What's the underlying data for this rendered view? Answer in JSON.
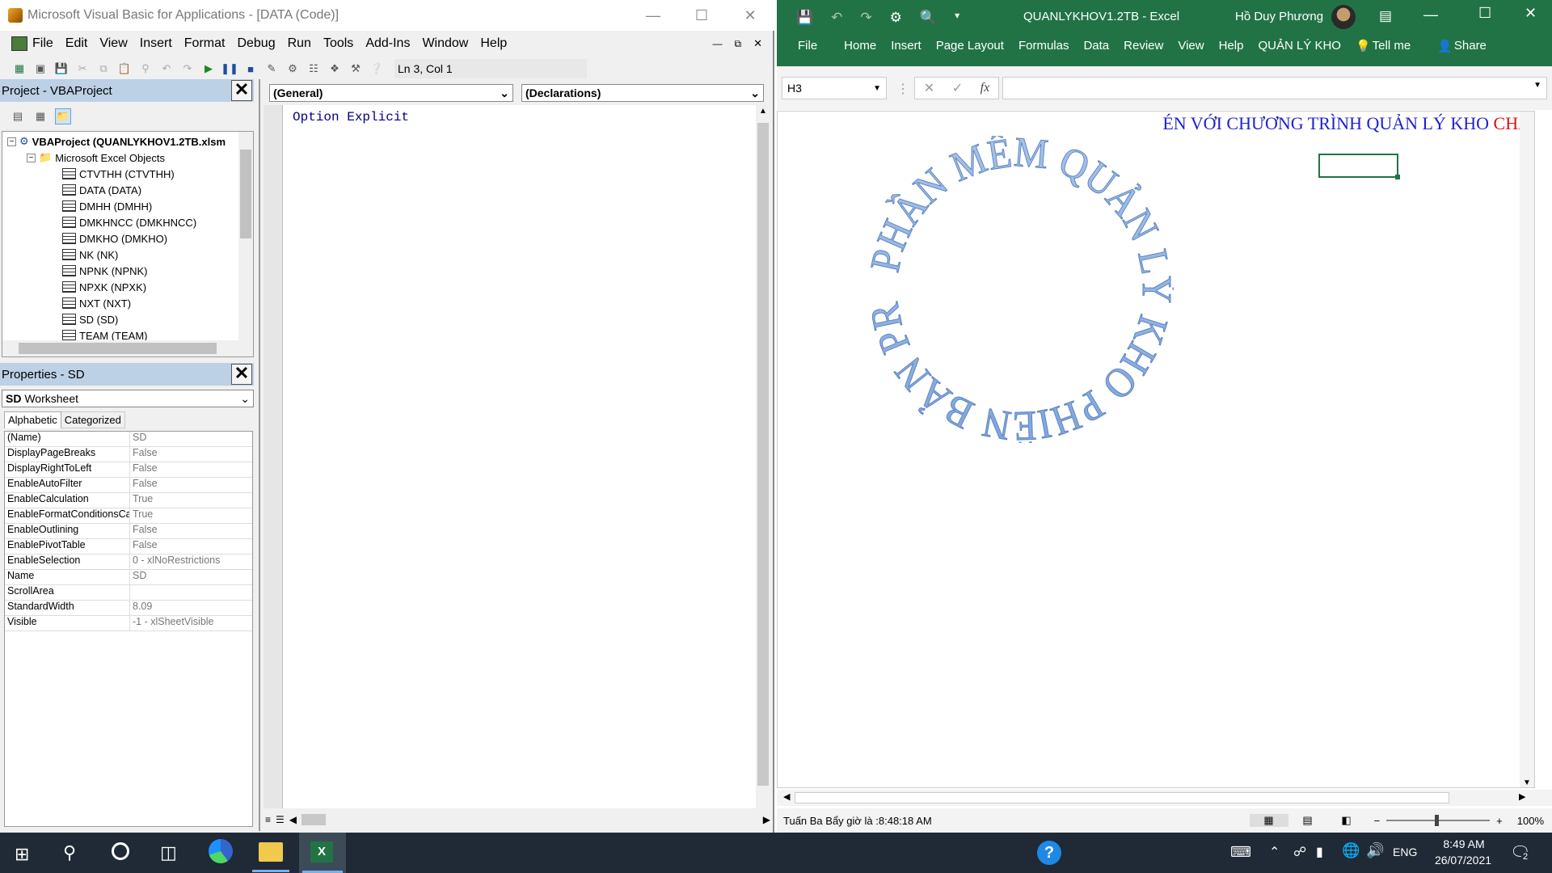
{
  "vba": {
    "title": "Microsoft Visual Basic for Applications - [DATA (Code)]",
    "menu": [
      "File",
      "Edit",
      "View",
      "Insert",
      "Format",
      "Debug",
      "Run",
      "Tools",
      "Add-Ins",
      "Window",
      "Help"
    ],
    "position": "Ln 3, Col 1",
    "project_title": "Project - VBAProject",
    "project_root": "VBAProject (QUANLYKHOV1.2TB.xlsm",
    "folder": "Microsoft Excel Objects",
    "sheets": [
      "CTVTHH (CTVTHH)",
      "DATA (DATA)",
      "DMHH (DMHH)",
      "DMKHNCC (DMKHNCC)",
      "DMKHO (DMKHO)",
      "NK (NK)",
      "NPNK (NPNK)",
      "NPXK (NPXK)",
      "NXT (NXT)",
      "SD (SD)",
      "TEAM (TEAM)"
    ],
    "properties_title": "Properties - SD",
    "object_name": "SD",
    "object_type": "Worksheet",
    "tab_alpha": "Alphabetic",
    "tab_cat": "Categorized",
    "properties": [
      [
        "(Name)",
        "SD"
      ],
      [
        "DisplayPageBreaks",
        "False"
      ],
      [
        "DisplayRightToLeft",
        "False"
      ],
      [
        "EnableAutoFilter",
        "False"
      ],
      [
        "EnableCalculation",
        "True"
      ],
      [
        "EnableFormatConditionsCa",
        "True"
      ],
      [
        "EnableOutlining",
        "False"
      ],
      [
        "EnablePivotTable",
        "False"
      ],
      [
        "EnableSelection",
        "0 - xlNoRestrictions"
      ],
      [
        "Name",
        "SD"
      ],
      [
        "ScrollArea",
        ""
      ],
      [
        "StandardWidth",
        "8.09"
      ],
      [
        "Visible",
        "-1 - xlSheetVisible"
      ]
    ],
    "combo_general": "(General)",
    "combo_decl": "(Declarations)",
    "code": "Option Explicit"
  },
  "excel": {
    "title": "QUANLYKHOV1.2TB  -  Excel",
    "user": "Hồ Duy Phương",
    "tabs": [
      "File",
      "Home",
      "Insert",
      "Page Layout",
      "Formulas",
      "Data",
      "Review",
      "View",
      "Help",
      "QUẢN LÝ KHO"
    ],
    "tell_me": "Tell me",
    "share": "Share",
    "name_box": "H3",
    "fx": "fx",
    "banner_blue": "ÉN VỚI CHƯƠNG TRÌNH QUẢN LÝ KHO ",
    "banner_red": "CHÀ",
    "wordart": "PHẦN MỀM QUẢN LÝ KHO PHIÊN BẢN PRO",
    "status_text": "Tuấn Ba Bẩy giờ là :8:48:18 AM",
    "zoom": "100%",
    "color_ribbon": "#217346"
  },
  "taskbar": {
    "lang": "ENG",
    "time": "8:49 AM",
    "date": "26/07/2021",
    "notif": "2"
  }
}
